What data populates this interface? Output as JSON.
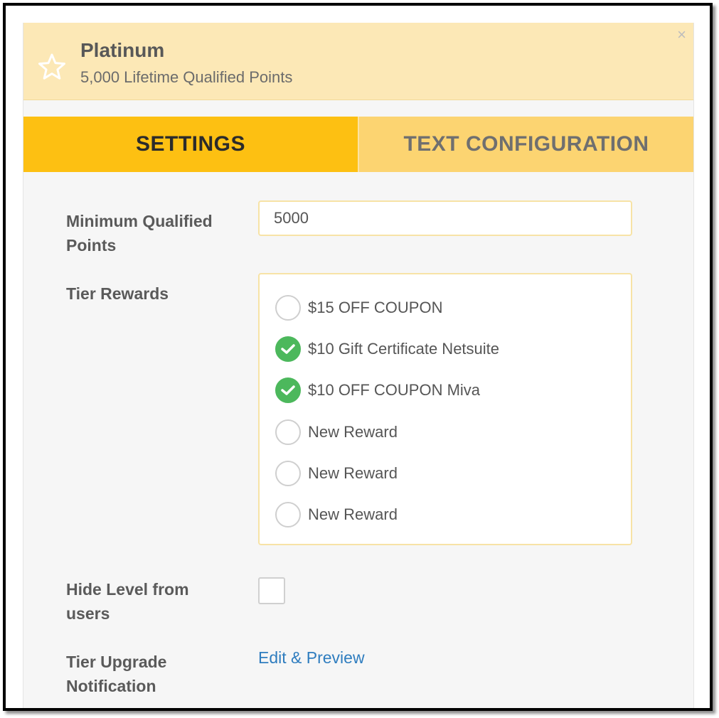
{
  "header": {
    "tier_name": "Platinum",
    "subtitle": "5,000 Lifetime Qualified Points",
    "close_glyph": "×"
  },
  "tabs": [
    {
      "label": "SETTINGS",
      "active": true
    },
    {
      "label": "TEXT CONFIGURATION",
      "active": false
    }
  ],
  "form": {
    "min_points_label": "Minimum Qualified Points",
    "min_points_value": "5000",
    "tier_rewards_label": "Tier Rewards",
    "rewards": [
      {
        "label": "$15 OFF COUPON",
        "checked": false
      },
      {
        "label": "$10 Gift Certificate Netsuite",
        "checked": true
      },
      {
        "label": "$10 OFF COUPON Miva",
        "checked": true
      },
      {
        "label": "New Reward",
        "checked": false
      },
      {
        "label": "New Reward",
        "checked": false
      },
      {
        "label": "New Reward",
        "checked": false
      }
    ],
    "hide_level_label": "Hide Level from users",
    "hide_level_checked": false,
    "upgrade_notification_label": "Tier Upgrade Notification",
    "edit_preview_link": "Edit & Preview"
  },
  "colors": {
    "header_bg": "#fce8b6",
    "tab_active": "#fdc012",
    "tab_inactive": "#fcd471",
    "check_green": "#4cb85c",
    "link_blue": "#2f7dbf"
  },
  "icons": {
    "header": "star-outline-icon",
    "close": "close-icon",
    "checked_reward": "checkmark-icon"
  }
}
